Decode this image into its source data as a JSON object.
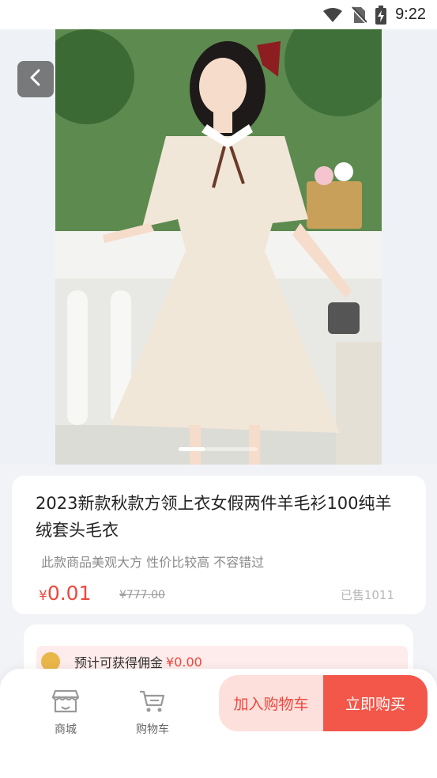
{
  "status_bar": {
    "time": "9:22"
  },
  "product": {
    "title": "2023新款秋款方领上衣女假两件羊毛衫100纯羊绒套头毛衣",
    "description": "此款商品美观大方 性价比较高 不容错过",
    "price_symbol": "¥",
    "price": "0.01",
    "original_price": "¥777.00",
    "sold": "已售1011"
  },
  "commission": {
    "label": "预计可获得佣金",
    "amount": "¥0.00"
  },
  "bottom_nav": {
    "mall_label": "商城",
    "cart_label": "购物车",
    "add_cart_label": "加入购物车",
    "buy_now_label": "立即购买"
  },
  "carousel": {
    "current_page": 1
  },
  "colors": {
    "accent": "#f0463c",
    "buy_button": "#f2574a",
    "cart_button_bg": "#fde0dc"
  }
}
